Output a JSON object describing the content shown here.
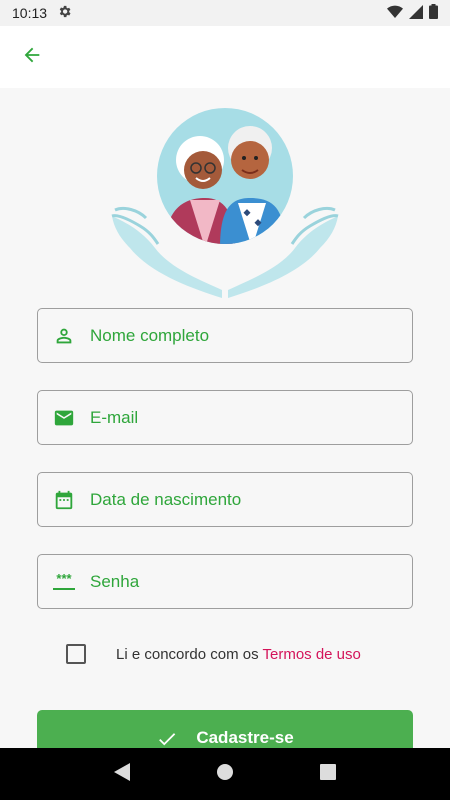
{
  "status_bar": {
    "time": "10:13"
  },
  "form": {
    "name_placeholder": "Nome completo",
    "email_placeholder": "E-mail",
    "birthdate_placeholder": "Data de nascimento",
    "password_placeholder": "Senha",
    "password_icon_text": "***"
  },
  "terms": {
    "text": "Li e concordo com os ",
    "link": "Termos de uso"
  },
  "submit": {
    "label": "Cadastre-se"
  },
  "colors": {
    "accent": "#2fa63b",
    "button": "#4caf50",
    "link": "#d3145a"
  }
}
